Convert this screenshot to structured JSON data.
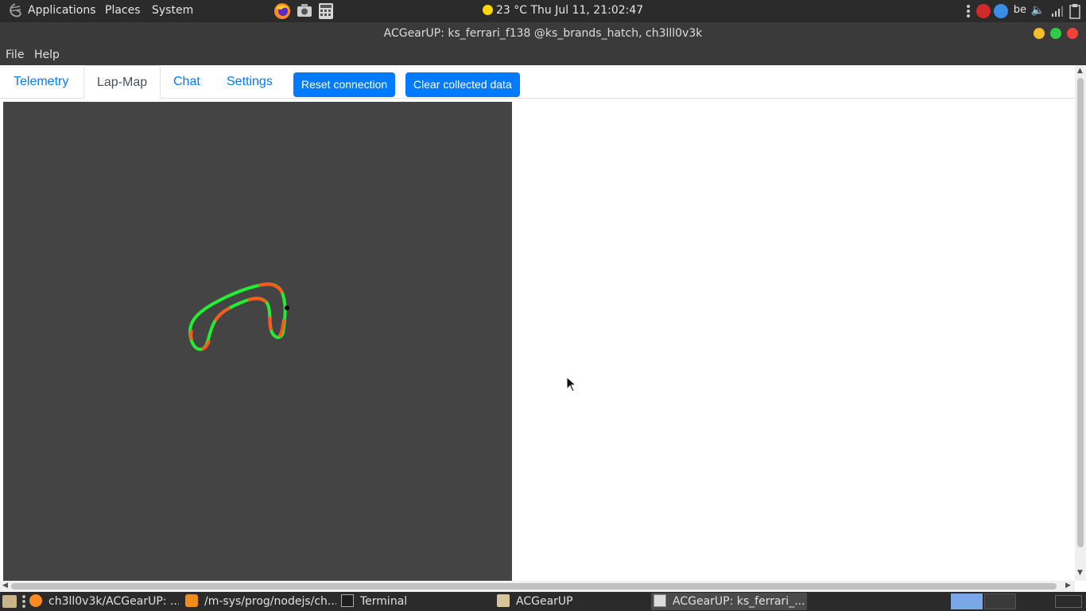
{
  "top_panel": {
    "menus": [
      "Applications",
      "Places",
      "System"
    ],
    "weather_clock": "23 °C Thu Jul 11, 21:02:47",
    "launchers": [
      "firefox-icon",
      "screenshot-icon",
      "calculator-icon"
    ],
    "keyboard_layout": "be"
  },
  "window": {
    "title": "ACGearUP: ks_ferrari_f138 @ks_brands_hatch, ch3lll0v3k"
  },
  "menubar": {
    "items": [
      "File",
      "Help"
    ]
  },
  "tabs": [
    {
      "label": "Telemetry",
      "active": false
    },
    {
      "label": "Lap-Map",
      "active": true
    },
    {
      "label": "Chat",
      "active": false
    },
    {
      "label": "Settings",
      "active": false
    }
  ],
  "buttons": {
    "reset": "Reset connection",
    "clear": "Clear collected data"
  },
  "lapmap": {
    "background": "#444444",
    "track_colors": {
      "fast": "#22ee33",
      "slow": "#ff5a1a",
      "car_marker": "#000000"
    }
  },
  "taskbar": {
    "tasks": [
      {
        "label": "ch3ll0v3k/ACGearUP: ...",
        "icon": "firefox-icon"
      },
      {
        "label": "/m-sys/prog/nodejs/ch...",
        "icon": "sublime-text-icon"
      },
      {
        "label": "Terminal",
        "icon": "terminal-icon"
      },
      {
        "label": "ACGearUP",
        "icon": "folder-icon"
      },
      {
        "label": "ACGearUP: ks_ferrari_...",
        "icon": "window-icon",
        "active": true
      }
    ]
  }
}
